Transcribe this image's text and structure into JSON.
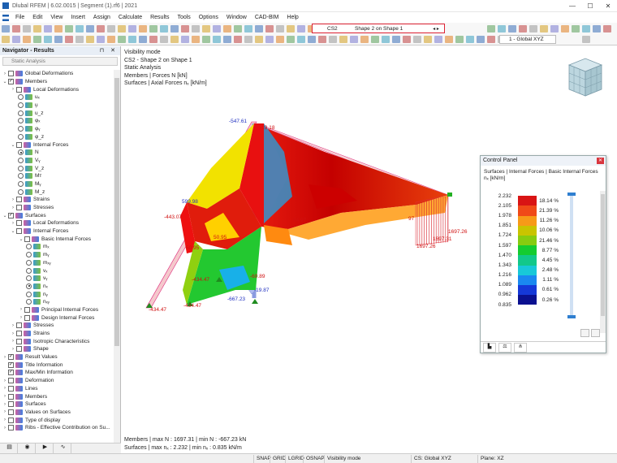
{
  "window": {
    "title": "Dlubal RFEM | 6.02.0015 | Segment (1).rf6 | 2021"
  },
  "menu": [
    "File",
    "Edit",
    "View",
    "Insert",
    "Assign",
    "Calculate",
    "Results",
    "Tools",
    "Options",
    "Window",
    "CAD-BIM",
    "Help"
  ],
  "toolbar": {
    "load_case": "CS2",
    "load_case_name": "Shape 2 on Shape 1",
    "coord_system": "1 - Global XYZ"
  },
  "navigator": {
    "title": "Navigator - Results",
    "combo": "Static Analysis",
    "items": [
      {
        "label": "Global Deformations",
        "level": 0,
        "kind": "cb",
        "expand": "›",
        "checked": false
      },
      {
        "label": "Members",
        "level": 0,
        "kind": "cb",
        "expand": "⌄",
        "checked": true
      },
      {
        "label": "Local Deformations",
        "level": 1,
        "kind": "cb",
        "expand": "›",
        "checked": false
      },
      {
        "label": "uₓ",
        "level": 2,
        "kind": "rb",
        "on": false
      },
      {
        "label": "u᷊",
        "level": 2,
        "kind": "rb",
        "on": false
      },
      {
        "label": "u_z",
        "level": 2,
        "kind": "rb",
        "on": false
      },
      {
        "label": "φₓ",
        "level": 2,
        "kind": "rb",
        "on": false
      },
      {
        "label": "φᵧ",
        "level": 2,
        "kind": "rb",
        "on": false
      },
      {
        "label": "φ_z",
        "level": 2,
        "kind": "rb",
        "on": false
      },
      {
        "label": "Internal Forces",
        "level": 1,
        "kind": "cb",
        "expand": "⌄",
        "checked": false
      },
      {
        "label": "N",
        "level": 2,
        "kind": "rb",
        "on": true
      },
      {
        "label": "Vᵧ",
        "level": 2,
        "kind": "rb",
        "on": false
      },
      {
        "label": "V_z",
        "level": 2,
        "kind": "rb",
        "on": false
      },
      {
        "label": "Mт",
        "level": 2,
        "kind": "rb",
        "on": false
      },
      {
        "label": "Mᵧ",
        "level": 2,
        "kind": "rb",
        "on": false
      },
      {
        "label": "M_z",
        "level": 2,
        "kind": "rb",
        "on": false
      },
      {
        "label": "Strains",
        "level": 1,
        "kind": "cb",
        "expand": "›",
        "checked": false
      },
      {
        "label": "Stresses",
        "level": 1,
        "kind": "cb",
        "expand": "›",
        "checked": false
      },
      {
        "label": "Surfaces",
        "level": 0,
        "kind": "cb",
        "expand": "⌄",
        "checked": true
      },
      {
        "label": "Local Deformations",
        "level": 1,
        "kind": "cb",
        "expand": "›",
        "checked": false
      },
      {
        "label": "Internal Forces",
        "level": 1,
        "kind": "cb",
        "expand": "⌄",
        "checked": false
      },
      {
        "label": "Basic Internal Forces",
        "level": 2,
        "kind": "cb",
        "expand": "⌄",
        "checked": false
      },
      {
        "label": "mₓ",
        "level": 3,
        "kind": "rb",
        "on": false
      },
      {
        "label": "mᵧ",
        "level": 3,
        "kind": "rb",
        "on": false
      },
      {
        "label": "mₓᵧ",
        "level": 3,
        "kind": "rb",
        "on": false
      },
      {
        "label": "vₓ",
        "level": 3,
        "kind": "rb",
        "on": false
      },
      {
        "label": "vᵧ",
        "level": 3,
        "kind": "rb",
        "on": false
      },
      {
        "label": "nₓ",
        "level": 3,
        "kind": "rb",
        "on": true
      },
      {
        "label": "nᵧ",
        "level": 3,
        "kind": "rb",
        "on": false
      },
      {
        "label": "nₓᵧ",
        "level": 3,
        "kind": "rb",
        "on": false
      },
      {
        "label": "Principal Internal Forces",
        "level": 2,
        "kind": "cb",
        "expand": "›",
        "checked": false
      },
      {
        "label": "Design Internal Forces",
        "level": 2,
        "kind": "cb",
        "expand": "›",
        "checked": false
      },
      {
        "label": "Stresses",
        "level": 1,
        "kind": "cb",
        "expand": "›",
        "checked": false
      },
      {
        "label": "Strains",
        "level": 1,
        "kind": "cb",
        "expand": "›",
        "checked": false
      },
      {
        "label": "Isotropic Characteristics",
        "level": 1,
        "kind": "cb",
        "expand": "›",
        "checked": false
      },
      {
        "label": "Shape",
        "level": 1,
        "kind": "cb",
        "expand": "›",
        "checked": false
      },
      {
        "label": "Result Values",
        "level": 0,
        "kind": "cb",
        "expand": "›",
        "checked": true
      },
      {
        "label": "Title Information",
        "level": 0,
        "kind": "cb",
        "expand": "",
        "checked": true
      },
      {
        "label": "Max/Min Information",
        "level": 0,
        "kind": "cb",
        "expand": "",
        "checked": true
      },
      {
        "label": "Deformation",
        "level": 0,
        "kind": "cb",
        "expand": "›",
        "checked": false
      },
      {
        "label": "Lines",
        "level": 0,
        "kind": "cb",
        "expand": "›",
        "checked": false
      },
      {
        "label": "Members",
        "level": 0,
        "kind": "cb",
        "expand": "›",
        "checked": false
      },
      {
        "label": "Surfaces",
        "level": 0,
        "kind": "cb",
        "expand": "›",
        "checked": false
      },
      {
        "label": "Values on Surfaces",
        "level": 0,
        "kind": "cb",
        "expand": "›",
        "checked": false
      },
      {
        "label": "Type of display",
        "level": 0,
        "kind": "cb",
        "expand": "›",
        "checked": false
      },
      {
        "label": "Ribs - Effective Contribution on Su...",
        "level": 0,
        "kind": "cb",
        "expand": "›",
        "checked": false
      }
    ]
  },
  "viewport": {
    "info": [
      "Visibility mode",
      "CS2 - Shape 2 on Shape 1",
      "Static Analysis",
      "Members | Forces N [kN]",
      "Surfaces | Axial Forces nₓ [kN/m]"
    ],
    "bottom": [
      "Members | max N : 1697.31 | min N : -667.23 kN",
      "Surfaces | max nₓ : 2.232 | min nₓ : 0.835 kN/m"
    ],
    "labels": {
      "l1": "-547.61",
      "l2": "-19.18",
      "l3": "599.98",
      "l4": "-443.07",
      "l5": "54.97",
      "l6": "-434.47",
      "l7": "50.95",
      "l8": "50.95",
      "l9": "-434.47",
      "l10": "-434.47",
      "l11": "-667.23",
      "l12": "-19.87",
      "l13": "-60.89",
      "l14": "1697.26",
      "l15": "1697.31",
      "l16": "1697.26",
      "l17": "97"
    }
  },
  "control_panel": {
    "title": "Control Panel",
    "subtitle": "Surfaces | Internal Forces | Basic Internal Forces",
    "unit": "nₓ [kN/m]",
    "legend": [
      {
        "value": "2.232",
        "pct": "",
        "color": "#b0001a"
      },
      {
        "value": "2.105",
        "pct": "18.14 %",
        "color": "#d91414"
      },
      {
        "value": "1.978",
        "pct": "21.39 %",
        "color": "#f04a18"
      },
      {
        "value": "1.851",
        "pct": "11.26 %",
        "color": "#f79a18"
      },
      {
        "value": "1.724",
        "pct": "10.06 %",
        "color": "#c9c400"
      },
      {
        "value": "1.597",
        "pct": "21.46 %",
        "color": "#86cc10"
      },
      {
        "value": "1.470",
        "pct": "8.77 %",
        "color": "#14cc30"
      },
      {
        "value": "1.343",
        "pct": "4.45 %",
        "color": "#12c88a"
      },
      {
        "value": "1.216",
        "pct": "2.48 %",
        "color": "#18c8d8"
      },
      {
        "value": "1.089",
        "pct": "1.11 %",
        "color": "#1a88f0"
      },
      {
        "value": "0.962",
        "pct": "0.61 %",
        "color": "#1538d8"
      },
      {
        "value": "0.835",
        "pct": "0.26 %",
        "color": "#0a1090"
      }
    ]
  },
  "status": {
    "snap": "SNAP",
    "grid": "GRID",
    "lgrid": "LGRID",
    "osnap": "OSNAP",
    "mode": "Visibility mode",
    "cs": "CS: Global XYZ",
    "plane": "Plane: XZ"
  }
}
